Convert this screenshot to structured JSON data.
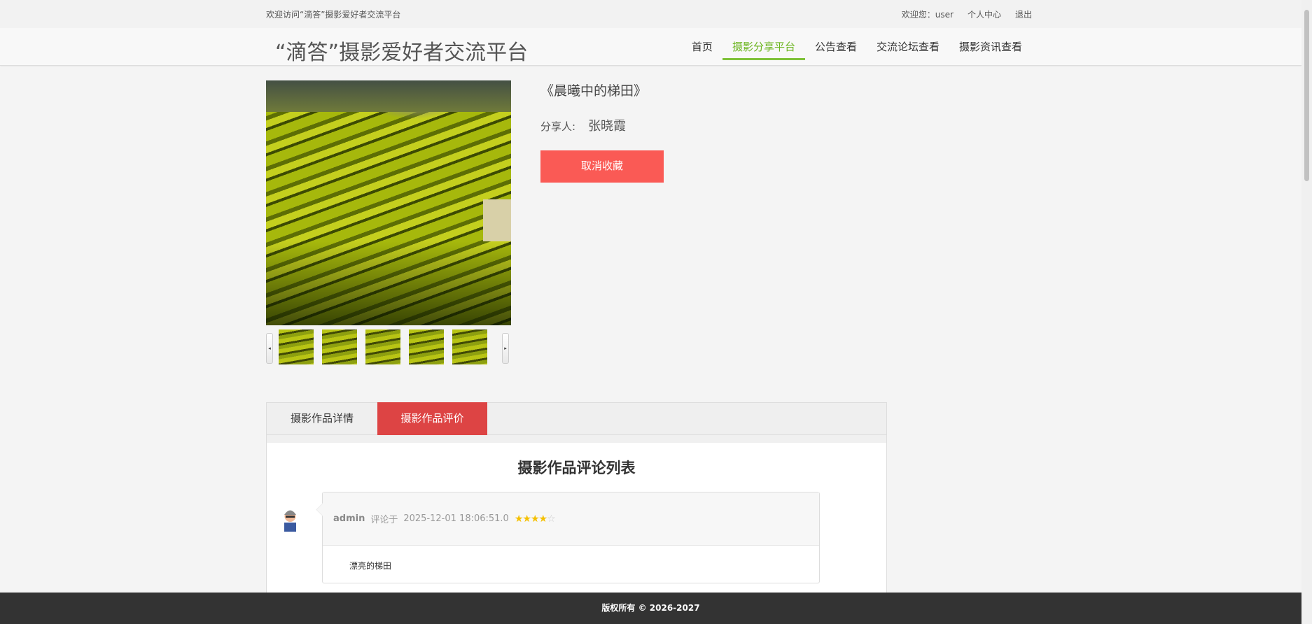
{
  "topbar": {
    "welcome": "欢迎访问“滴答”摄影爱好者交流平台",
    "user_greeting": "欢迎您：user",
    "profile": "个人中心",
    "logout": "退出"
  },
  "header": {
    "logo": "“滴答”摄影爱好者交流平台",
    "nav": [
      "首页",
      "摄影分享平台",
      "公告查看",
      "交流论坛查看",
      "摄影资讯查看"
    ],
    "active_nav": "摄影分享平台"
  },
  "work": {
    "title": "《晨曦中的梯田》",
    "sharer_label": "分享人:",
    "sharer": "张晓霞",
    "unfavorite": "取消收藏",
    "thumb_prev": "◂",
    "thumb_next": "▸"
  },
  "tabs": [
    "摄影作品详情",
    "摄影作品评价"
  ],
  "comments": {
    "heading": "摄影作品评论列表",
    "items": [
      {
        "user": "admin",
        "said": "评论于",
        "time": "2025-12-01 18:06:51.0",
        "rating": 4,
        "max": 5,
        "text": "漂亮的梯田"
      }
    ]
  },
  "footer": "版权所有 © 2026-2027",
  "colors": {
    "accent": "#7fc23a",
    "button": "#fa5a55",
    "tab_active": "#dd4444"
  }
}
